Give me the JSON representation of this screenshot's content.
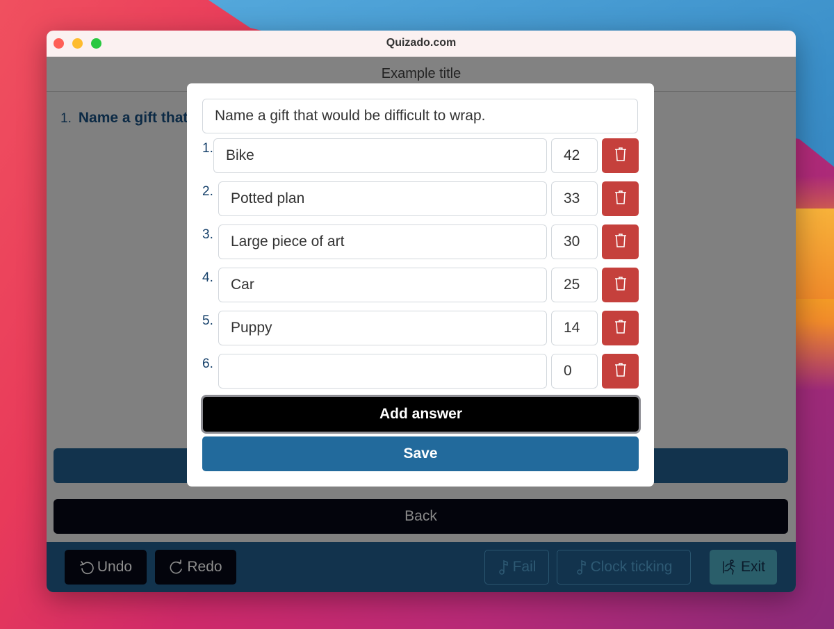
{
  "window": {
    "title": "Quizado.com"
  },
  "header": {
    "title": "Example title"
  },
  "question_list": {
    "number": "1.",
    "text": "Name a gift that would be difficult to wrap."
  },
  "modal": {
    "question_value": "Name a gift that would be difficult to wrap.",
    "answers": [
      {
        "number": "1.",
        "text": "Bike",
        "score": "42"
      },
      {
        "number": "2.",
        "text": "Potted plan",
        "score": "33"
      },
      {
        "number": "3.",
        "text": "Large piece of art",
        "score": "30"
      },
      {
        "number": "4.",
        "text": "Car",
        "score": "25"
      },
      {
        "number": "5.",
        "text": "Puppy",
        "score": "14"
      },
      {
        "number": "6.",
        "text": "",
        "score": "0"
      }
    ],
    "add_answer_label": "Add answer",
    "save_label": "Save",
    "delete_icon": "trash-icon"
  },
  "page": {
    "back_label": "Back"
  },
  "footer": {
    "undo_label": "Undo",
    "redo_label": "Redo",
    "fail_label": "Fail",
    "clock_label": "Clock ticking",
    "exit_label": "Exit"
  },
  "colors": {
    "delete": "#c5403c",
    "save": "#226a9c",
    "footer": "#12334d"
  }
}
